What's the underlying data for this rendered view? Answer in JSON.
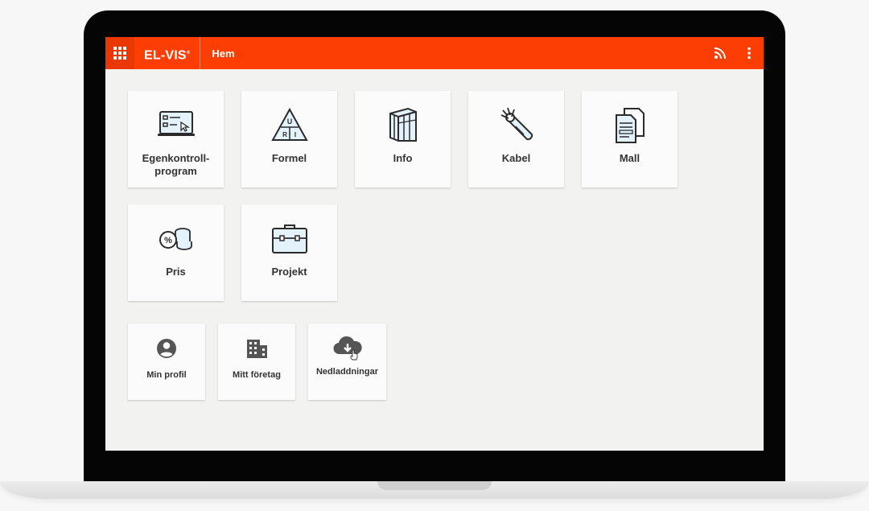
{
  "header": {
    "brand": "EL-VIS",
    "brand_mark": "®",
    "title": "Hem",
    "icons": [
      "apps-grid-icon",
      "rss-icon",
      "more-vert-icon"
    ]
  },
  "colors": {
    "primary": "#fc3d04",
    "tile_bg": "#fbfbfb",
    "screen_bg": "#f2f2f0",
    "icon_accent": "#e3f2fb"
  },
  "tiles": [
    {
      "label_line1": "Egenkontroll-",
      "label_line2": "program",
      "icon": "checklist-monitor-icon"
    },
    {
      "label": "Formel",
      "icon": "ohms-law-triangle-icon"
    },
    {
      "label": "Info",
      "icon": "books-icon"
    },
    {
      "label": "Kabel",
      "icon": "cable-icon"
    },
    {
      "label": "Mall",
      "icon": "documents-icon"
    },
    {
      "label": "Pris",
      "icon": "coins-percent-icon"
    },
    {
      "label": "Projekt",
      "icon": "briefcase-icon"
    }
  ],
  "shortcuts": [
    {
      "label": "Min profil",
      "icon": "account-circle-icon"
    },
    {
      "label": "Mitt företag",
      "icon": "building-icon"
    },
    {
      "label": "Nedladdningar",
      "icon": "cloud-download-icon"
    }
  ],
  "formula_glyphs": {
    "top": "U",
    "left": "R",
    "op": "•",
    "right": "I"
  }
}
